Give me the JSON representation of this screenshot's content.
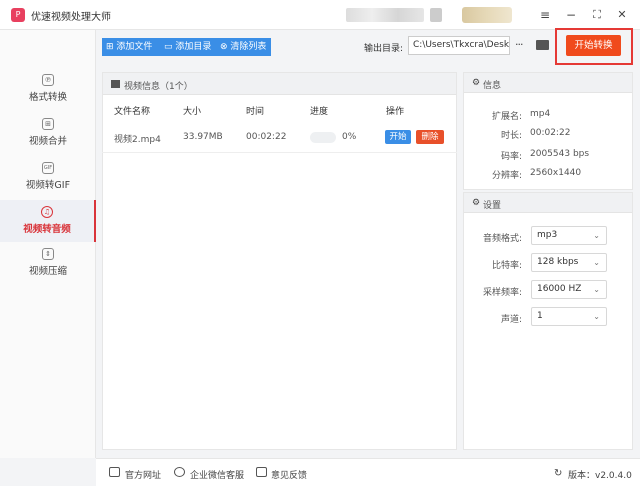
{
  "app": {
    "title": "优速视频处理大师",
    "logo_text": "P"
  },
  "window": {
    "menu_icon": "≡",
    "minimize": "−",
    "maximize": "⛶",
    "close": "✕"
  },
  "sidebar": {
    "items": [
      {
        "label": "格式转换",
        "icon": "℗"
      },
      {
        "label": "视频合并",
        "icon": "⊞"
      },
      {
        "label": "视频转GIF",
        "icon": "GIF"
      },
      {
        "label": "视频转音频",
        "icon": "♫"
      },
      {
        "label": "视频压缩",
        "icon": "⇕"
      }
    ],
    "active_index": 3
  },
  "toolbar": {
    "add_file": "添加文件",
    "add_folder": "添加目录",
    "clear_list": "清除列表",
    "output_label": "输出目录:",
    "output_path": "C:\\Users\\Tkxcra\\Deskto",
    "more": "···",
    "start": "开始转换"
  },
  "list": {
    "title": "视频信息（1个）",
    "headers": [
      "文件名称",
      "大小",
      "时间",
      "进度",
      "操作"
    ],
    "rows": [
      {
        "name": "视频2.mp4",
        "size": "33.97MB",
        "time": "00:02:22",
        "progress": "0%",
        "progress_value": 0,
        "start": "开始",
        "delete": "删除"
      }
    ]
  },
  "info": {
    "title": "信息",
    "fields": [
      {
        "key": "扩展名:",
        "value": "mp4"
      },
      {
        "key": "时长:",
        "value": "00:02:22"
      },
      {
        "key": "码率:",
        "value": "2005543 bps"
      },
      {
        "key": "分辨率:",
        "value": "2560x1440"
      }
    ]
  },
  "settings": {
    "title": "设置",
    "fields": [
      {
        "key": "音频格式:",
        "value": "mp3"
      },
      {
        "key": "比特率:",
        "value": "128 kbps"
      },
      {
        "key": "采样频率:",
        "value": "16000 HZ"
      },
      {
        "key": "声道:",
        "value": "1"
      }
    ]
  },
  "footer": {
    "website": "官方网址",
    "wechat": "企业微信客服",
    "feedback": "意见反馈",
    "version": "版本：v2.0.4.0"
  },
  "colors": {
    "accent": "#3a8ee6",
    "start": "#f04a1c",
    "highlight": "#e53935",
    "active": "#d9343a",
    "delete": "#e8502a"
  }
}
